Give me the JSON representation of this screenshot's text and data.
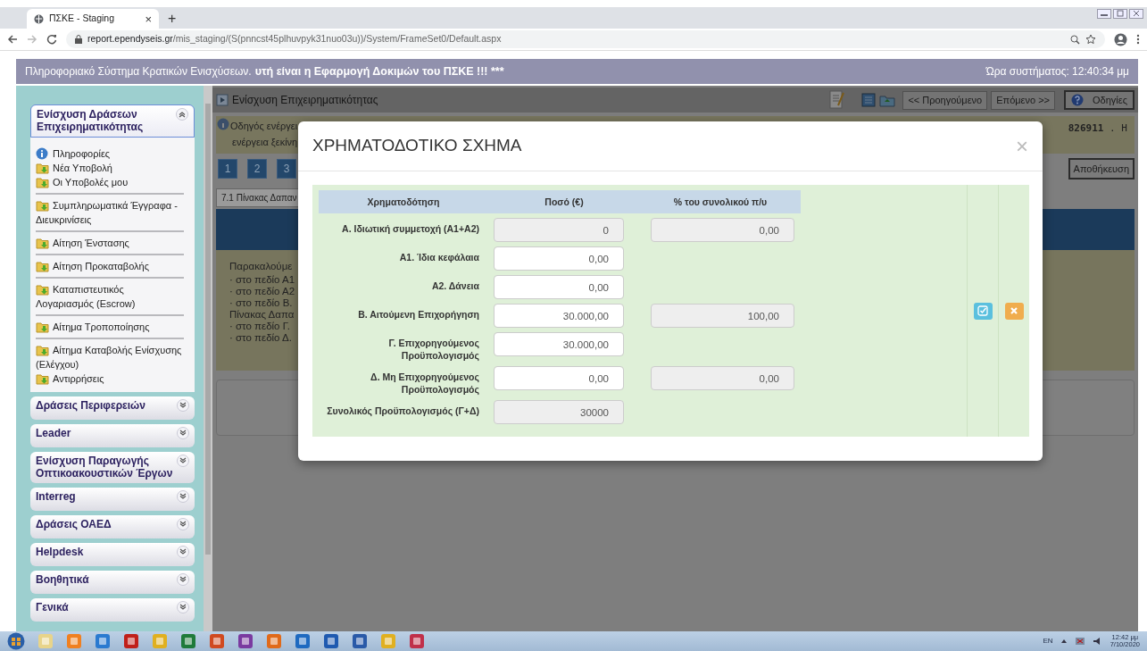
{
  "browser": {
    "tab_title": "ΠΣΚΕ - Staging",
    "tab_close": "×",
    "new_tab": "+",
    "url_domain": "report.ependyseis.gr",
    "url_path": "/mis_staging/(S(pnncst45plhuvpyk31nuo03u))/System/FrameSet0/Default.aspx"
  },
  "header": {
    "system_name": "Πληροφοριακό Σύστημα Κρατικών Ενισχύσεων.",
    "notice": "υτή είναι η Εφαρμογή Δοκιμών του ΠΣΚΕ !!! ***",
    "clock": "Ώρα συστήματος: 12:40:34 μμ"
  },
  "sidebar": {
    "sections": [
      {
        "title": "Ενίσχυση Δράσεων Επιχειρηματικότητας",
        "expanded": true,
        "groups": [
          [
            {
              "label": "Πληροφορίες",
              "kind": "info"
            },
            {
              "label": "Νέα Υποβολή",
              "kind": "folder"
            },
            {
              "label": "Οι Υποβολές μου",
              "kind": "folder"
            }
          ],
          [
            {
              "label": "Συμπληρωματικά Έγγραφα - Διευκρινίσεις",
              "kind": "folder"
            }
          ],
          [
            {
              "label": "Αίτηση Ένστασης",
              "kind": "folder"
            }
          ],
          [
            {
              "label": "Αίτηση Προκαταβολής",
              "kind": "folder"
            }
          ],
          [
            {
              "label": "Καταπιστευτικός Λογαριασμός (Escrow)",
              "kind": "folder"
            }
          ],
          [
            {
              "label": "Αίτημα Τροποποίησης",
              "kind": "folder"
            }
          ],
          [
            {
              "label": "Αίτημα Καταβολής Ενίσχυσης (Ελέγχου)",
              "kind": "folder"
            },
            {
              "label": "Αντιρρήσεις",
              "kind": "folder"
            }
          ]
        ]
      },
      {
        "title": "Δράσεις Περιφερειών",
        "expanded": false
      },
      {
        "title": "Leader",
        "expanded": false
      },
      {
        "title": "Ενίσχυση Παραγωγής Οπτικοακουστικών Έργων",
        "expanded": false
      },
      {
        "title": "Interreg",
        "expanded": false
      },
      {
        "title": "Δράσεις ΟΑΕΔ",
        "expanded": false
      },
      {
        "title": "Helpdesk",
        "expanded": false
      },
      {
        "title": "Βοηθητικά",
        "expanded": false
      },
      {
        "title": "Γενικά",
        "expanded": false
      }
    ]
  },
  "main": {
    "title": "Ενίσχυση Επιχειρηματικότητας",
    "nav_buttons": [
      "<< Προηγούμενο",
      "Επόμενο >>"
    ],
    "help": "Οδηγίες",
    "info_lines": [
      "Οδηγός ενέργει",
      "ενέργεια ξεκίνη"
    ],
    "info_right": "**826911** . Η",
    "steps": [
      "1",
      "2",
      "3"
    ],
    "save": "Αποθήκευση",
    "tab": "7.1 Πίνακας Δαπαν",
    "instructions": [
      "Παρακαλούμε",
      "· στο πεδίο Α1",
      "· στο πεδίο Α2",
      "· στο πεδίο Β.",
      "Πίνακας Δαπα",
      "· στο πεδίο Γ.",
      "· στο πεδίο Δ."
    ]
  },
  "modal": {
    "title": "ΧΡΗΜΑΤΟΔΟΤΙΚΟ ΣΧΗΜΑ",
    "close": "×",
    "columns": [
      "Χρηματοδότηση",
      "Ποσό (€)",
      "% του συνολικού π/υ"
    ],
    "rows": [
      {
        "label": "Α. Ιδιωτική συμμετοχή (Α1+Α2)",
        "amount": {
          "value": "0",
          "disabled": true
        },
        "percent": {
          "value": "0,00",
          "disabled": true
        }
      },
      {
        "label": "Α1. Ίδια κεφάλαια",
        "amount": {
          "value": "0,00",
          "disabled": false
        }
      },
      {
        "label": "Α2. Δάνεια",
        "amount": {
          "value": "0,00",
          "disabled": false
        }
      },
      {
        "label": "Β. Αιτούμενη Επιχορήγηση",
        "amount": {
          "value": "30.000,00",
          "disabled": false
        },
        "percent": {
          "value": "100,00",
          "disabled": true
        }
      },
      {
        "label": "Γ. Επιχορηγούμενος Προϋπολογισμός",
        "amount": {
          "value": "30.000,00",
          "disabled": false
        }
      },
      {
        "label": "Δ. Μη Επιχορηγούμενος Προϋπολογισμός",
        "amount": {
          "value": "0,00",
          "disabled": false
        },
        "percent": {
          "value": "0,00",
          "disabled": true
        }
      },
      {
        "label": "Συνολικός Προϋπολογισμός (Γ+Δ)",
        "amount": {
          "value": "30000",
          "disabled": true
        }
      }
    ]
  },
  "taskbar": {
    "language": "EN",
    "time": "12:42 μμ",
    "date": "7/10/2020"
  }
}
